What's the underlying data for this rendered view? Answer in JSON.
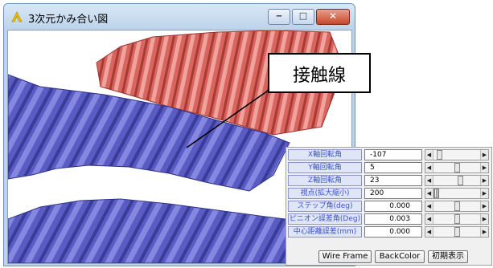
{
  "window": {
    "title": "3次元かみ合い図",
    "controls": {
      "minimize": "‒",
      "maximize": "□",
      "close": "✕"
    }
  },
  "callout": {
    "label": "接触線"
  },
  "colors": {
    "gear_top": "#d9655f",
    "gear_bottom": "#5a5cc4",
    "label_text": "#3e52c8"
  },
  "icons": {
    "app": "app-logo-icon"
  },
  "controls": [
    {
      "label": "X軸回転角",
      "value": "-107",
      "slider_fraction": 0.2
    },
    {
      "label": "Y軸回転角",
      "value": "5",
      "slider_fraction": 0.5
    },
    {
      "label": "Z軸回転角",
      "value": "23",
      "slider_fraction": 0.55
    },
    {
      "label": "視点(拡大縮小)",
      "value": "200",
      "slider_fraction": 0.05
    },
    {
      "label": "ステップ角(deg)",
      "value": "0.000",
      "slider_fraction": 0.5
    },
    {
      "label": "ピニオン誤差角(Deg)",
      "value": "0.003",
      "slider_fraction": 0.5
    },
    {
      "label": "中心距離誤差(mm)",
      "value": "0.000",
      "slider_fraction": 0.5
    }
  ],
  "buttons": {
    "wire_frame": "Wire Frame",
    "back_color": "BackColor",
    "initial_view": "初期表示"
  }
}
